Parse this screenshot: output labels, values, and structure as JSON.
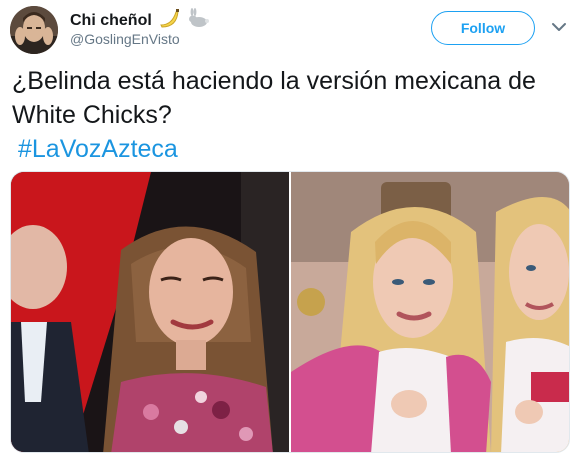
{
  "tweet": {
    "display_name": "Chi cheñol",
    "handle": "@GoslingEnVisto",
    "follow_label": "Follow",
    "text": "¿Belinda está haciendo la versión mexicana de White Chicks?",
    "hashtag": "#LaVozAzteca"
  },
  "icons": {
    "name_emojis": [
      "banana-icon",
      "rabbit-icon"
    ],
    "menu": "chevron-down-icon"
  },
  "colors": {
    "accent": "#1da1f2",
    "hashtag": "#1b95e0",
    "text": "#14171a",
    "secondary": "#657786"
  }
}
